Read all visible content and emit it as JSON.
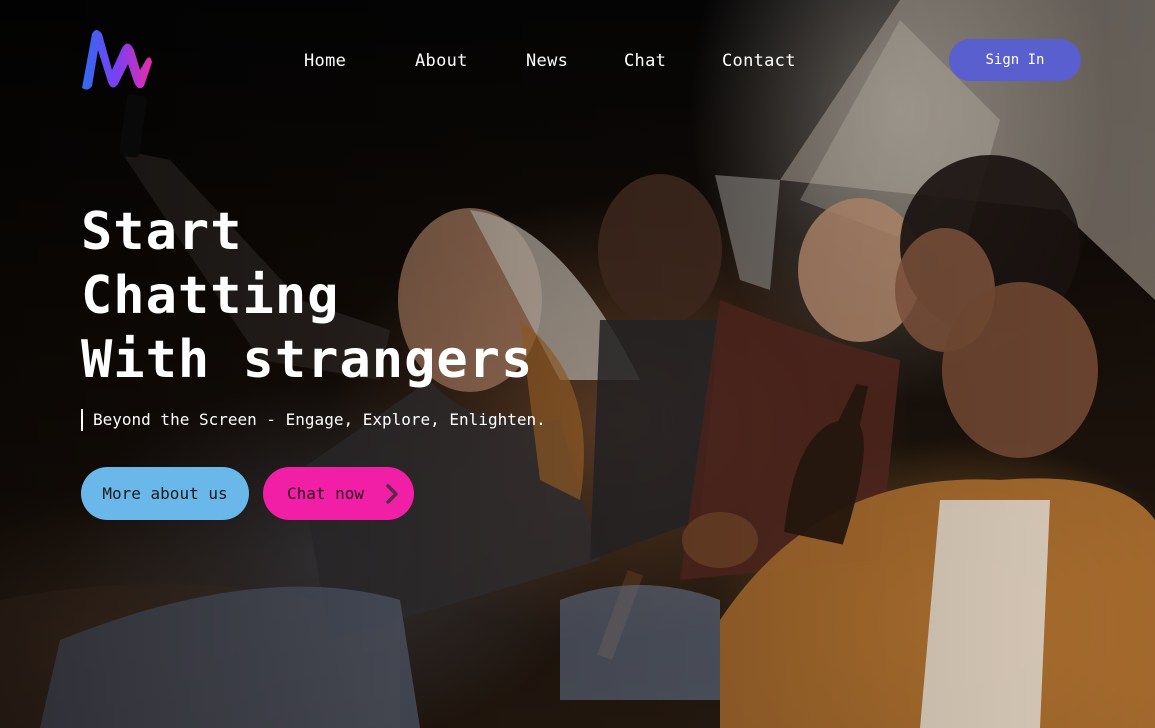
{
  "brand": {
    "logo_icon": "m-wave-logo-icon",
    "colors": {
      "logo_gradient": [
        "#2f6df0",
        "#7b3ff2",
        "#e92ca8"
      ],
      "sign_in": "#5a5fcf",
      "primary_button": "#6ab7ea",
      "accent_button": "#f01fa5",
      "text": "#ffffff"
    }
  },
  "nav": {
    "items": [
      {
        "label": "Home"
      },
      {
        "label": "About"
      },
      {
        "label": "News"
      },
      {
        "label": "Chat"
      },
      {
        "label": "Contact"
      }
    ],
    "sign_in_label": "Sign In"
  },
  "hero": {
    "headline_lines": [
      "Start",
      "Chatting",
      "With strangers"
    ],
    "tagline": "Beyond the Screen - Engage, Explore, Enlighten.",
    "buttons": {
      "more_about": "More about us",
      "chat_now": "Chat now",
      "chat_now_icon": "chevron-right-icon"
    },
    "background": "friends-taking-selfie-at-night-photo"
  }
}
